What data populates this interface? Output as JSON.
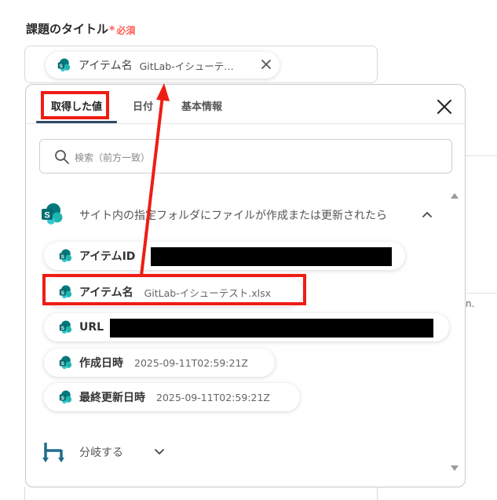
{
  "field": {
    "label": "課題のタイトル",
    "required": "必須"
  },
  "chip": {
    "label": "アイテム名",
    "value": "GitLab-イシューテスト.xlsx"
  },
  "background": {
    "partial_text": "n."
  },
  "tabs": [
    {
      "label": "取得した値",
      "active": true
    },
    {
      "label": "日付",
      "active": false
    },
    {
      "label": "基本情報",
      "active": false
    }
  ],
  "search": {
    "placeholder": "検索（前方一致）"
  },
  "group": {
    "title": "サイト内の指定フォルダにファイルが作成または更新されたら",
    "expanded": true
  },
  "items": [
    {
      "label": "アイテムID",
      "value": "",
      "redacted": true
    },
    {
      "label": "アイテム名",
      "value": "GitLab-イシューテスト.xlsx",
      "redacted": false
    },
    {
      "label": "URL",
      "value": "",
      "redacted": true
    },
    {
      "label": "作成日時",
      "value": "2025-09-11T02:59:21Z",
      "redacted": false
    },
    {
      "label": "最終更新日時",
      "value": "2025-09-11T02:59:21Z",
      "redacted": false
    }
  ],
  "branch": {
    "label": "分岐する"
  },
  "icons": {
    "sharepoint": "sharepoint-icon",
    "branch": "branch-icon",
    "close": "close-icon",
    "search": "search-icon"
  },
  "colors": {
    "accent_tab": "#2f4a64",
    "highlight": "#ee1d14",
    "required": "#ff5e55",
    "sharepoint_dark": "#03787c",
    "sharepoint_light": "#1fb5b0",
    "branch": "#1f6e8c"
  }
}
